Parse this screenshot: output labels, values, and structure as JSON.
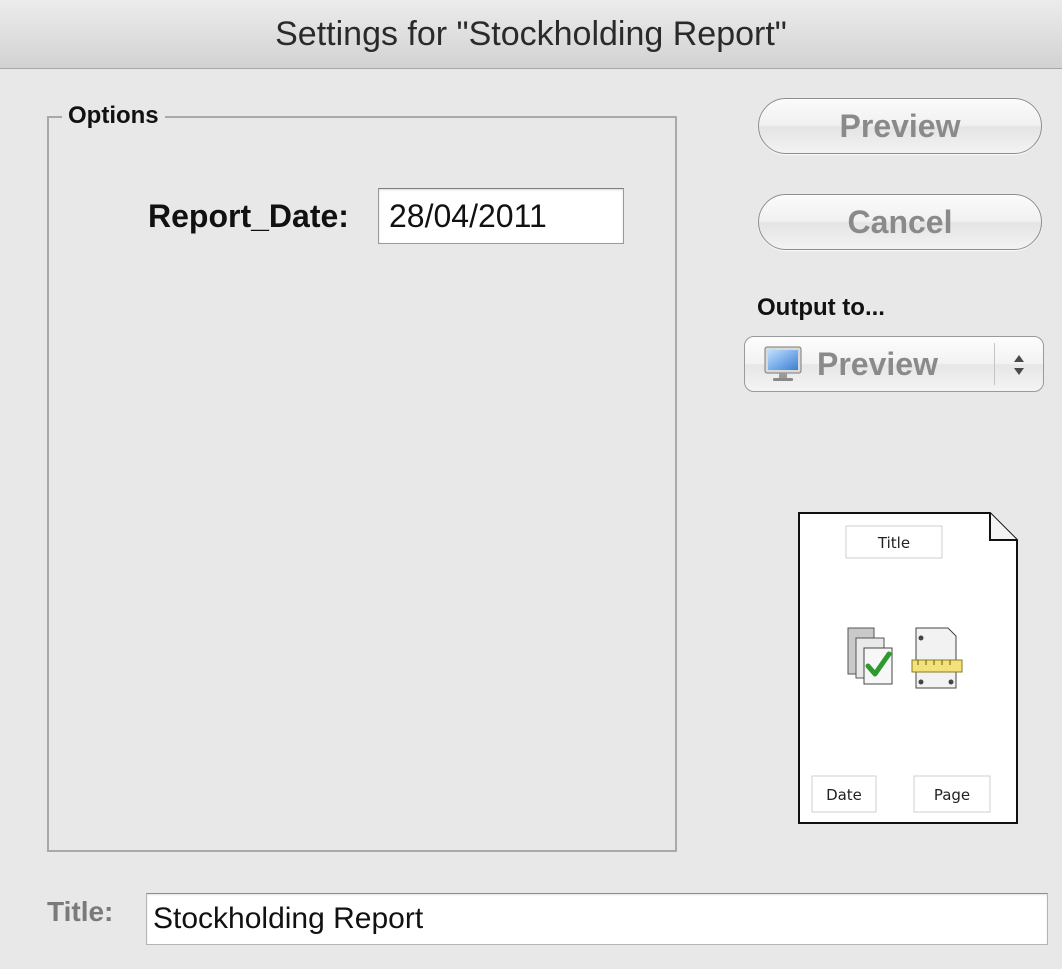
{
  "window": {
    "title": "Settings for \"Stockholding Report\""
  },
  "options": {
    "legend": "Options",
    "report_date_label": "Report_Date:",
    "report_date_value": "28/04/2011"
  },
  "buttons": {
    "preview_label": "Preview",
    "cancel_label": "Cancel"
  },
  "output": {
    "label": "Output to...",
    "selected": "Preview",
    "selected_icon": "monitor-icon"
  },
  "page_preview": {
    "title_label": "Title",
    "date_label": "Date",
    "page_label": "Page",
    "icons": [
      "printer-check-icon",
      "page-setup-ruler-icon"
    ]
  },
  "title_field": {
    "label": "Title:",
    "value": "Stockholding Report"
  }
}
